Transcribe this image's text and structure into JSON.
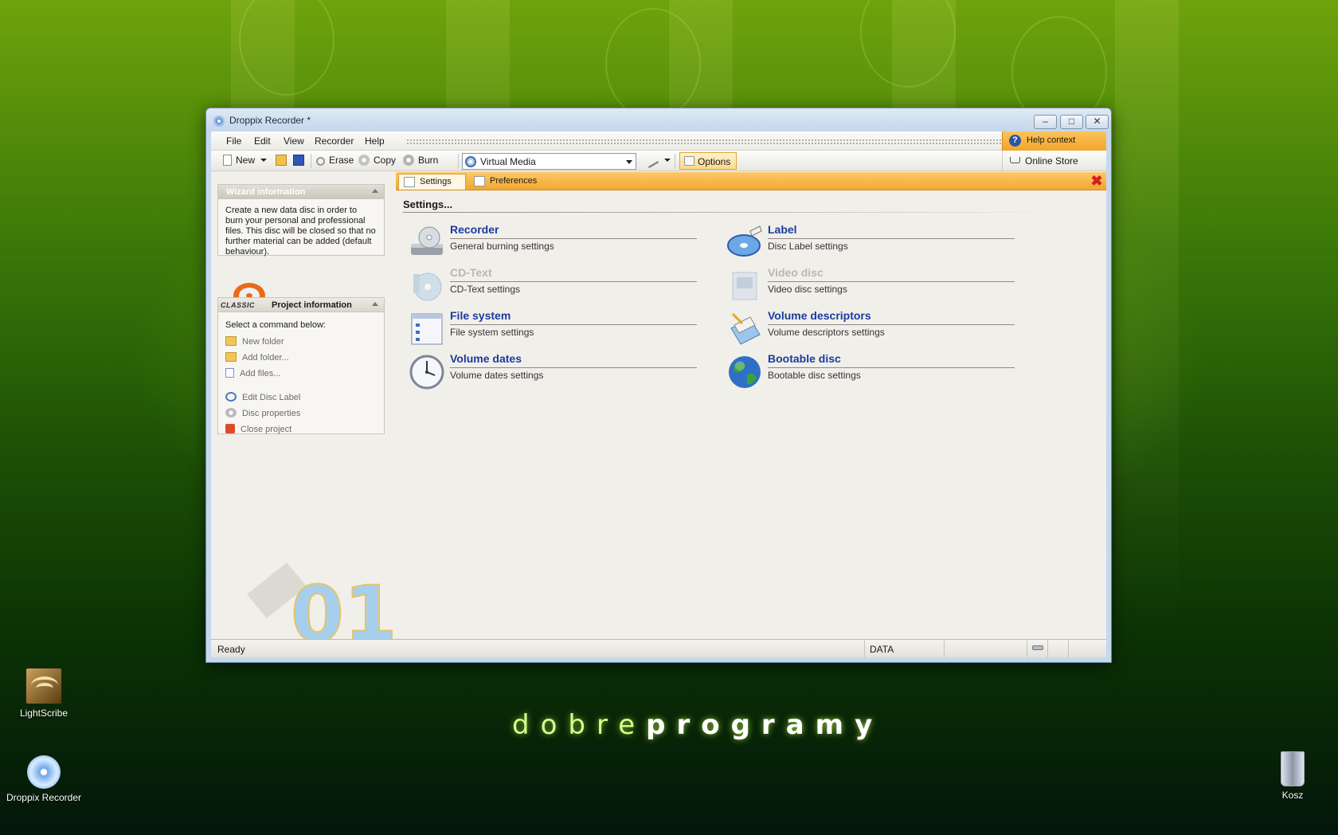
{
  "window": {
    "title": "Droppix Recorder *"
  },
  "menu": {
    "items": [
      "File",
      "Edit",
      "View",
      "Recorder",
      "Help"
    ],
    "help_context": "Help context"
  },
  "toolbar": {
    "new_label": "New",
    "erase_label": "Erase",
    "copy_label": "Copy",
    "burn_label": "Burn",
    "media_value": "Virtual Media",
    "options_label": "Options",
    "online_store_label": "Online Store"
  },
  "wizard": {
    "header": "Wizard information",
    "text": "Create a new data disc in order to burn your personal and professional files. This disc will be closed so that no further material can be added (default behaviour)."
  },
  "project": {
    "header": "Project information",
    "logo_text": "CLASSIC",
    "prompt": "Select a command below:",
    "commands": [
      "New folder",
      "Add folder...",
      "Add files...",
      "Edit Disc Label",
      "Disc properties",
      "Close project"
    ]
  },
  "tabs": {
    "settings": "Settings",
    "preferences": "Preferences"
  },
  "settings": {
    "title": "Settings...",
    "items": [
      {
        "name": "Recorder",
        "desc": "General burning settings",
        "icon": "recorder-drive-icon",
        "enabled": true
      },
      {
        "name": "Label",
        "desc": "Disc Label settings",
        "icon": "disc-label-icon",
        "enabled": true
      },
      {
        "name": "CD-Text",
        "desc": "CD-Text settings",
        "icon": "cd-text-icon",
        "enabled": false
      },
      {
        "name": "Video disc",
        "desc": "Video disc settings",
        "icon": "video-disc-icon",
        "enabled": false
      },
      {
        "name": "File system",
        "desc": "File system settings",
        "icon": "file-system-icon",
        "enabled": true
      },
      {
        "name": "Volume descriptors",
        "desc": "Volume descriptors settings",
        "icon": "volume-descriptors-icon",
        "enabled": true
      },
      {
        "name": "Volume dates",
        "desc": "Volume dates settings",
        "icon": "clock-icon",
        "enabled": true
      },
      {
        "name": "Bootable disc",
        "desc": "Bootable disc settings",
        "icon": "globe-icon",
        "enabled": true
      }
    ]
  },
  "statusbar": {
    "status": "Ready",
    "mode": "DATA"
  },
  "desktop": {
    "icons": [
      "LightScribe",
      "Droppix Recorder",
      "Kosz"
    ],
    "brand_light": "dobre",
    "brand_bold": "programy"
  },
  "colors": {
    "accent_orange": "#f3a82e",
    "link_blue": "#1b3b9e",
    "disabled_gray": "#b7b7b3"
  }
}
